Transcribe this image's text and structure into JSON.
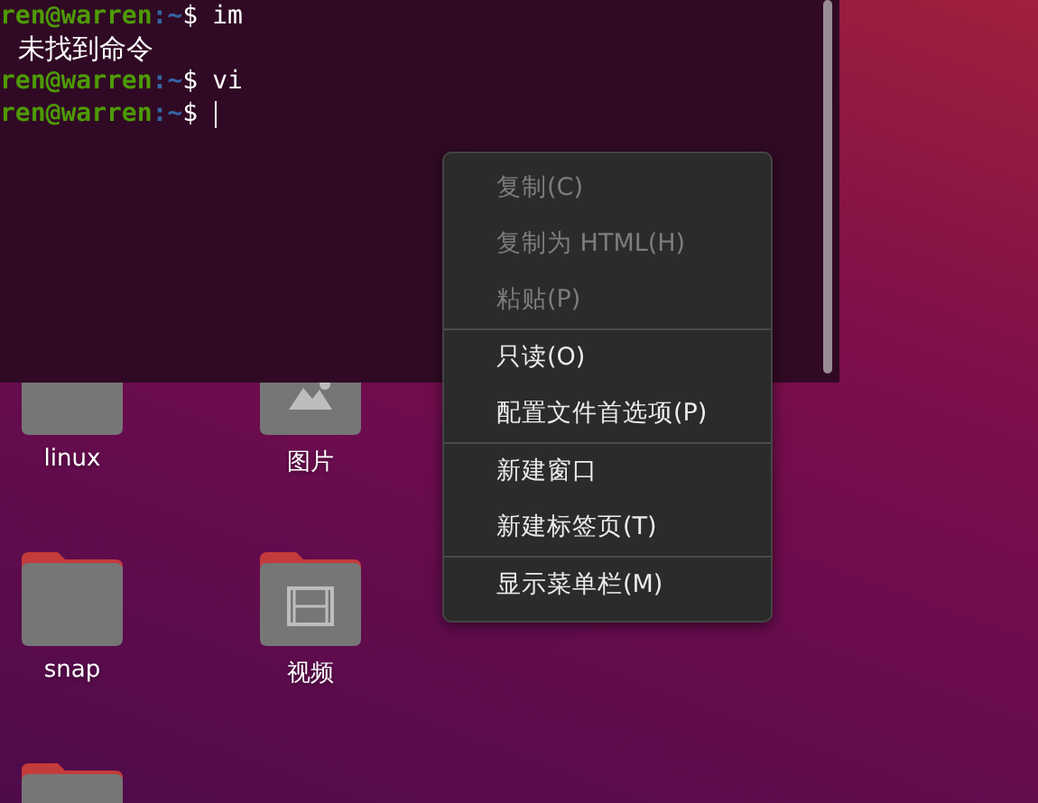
{
  "terminal": {
    "lines": [
      {
        "kind": "prompt",
        "user": "ren@warren",
        "path": ":~",
        "sign": "$",
        "command": "im",
        "cursor": false
      },
      {
        "kind": "output",
        "text": "未找到命令"
      },
      {
        "kind": "prompt",
        "user": "ren@warren",
        "path": ":~",
        "sign": "$",
        "command": "vi",
        "cursor": false
      },
      {
        "kind": "prompt",
        "user": "ren@warren",
        "path": ":~",
        "sign": "$",
        "cursor": true
      }
    ]
  },
  "desktop_icons": [
    {
      "label": "linux",
      "kind": "folder"
    },
    {
      "label": "图片",
      "kind": "pictures"
    },
    {
      "label": "snap",
      "kind": "folder"
    },
    {
      "label": "视频",
      "kind": "videos"
    },
    {
      "kind": "folder"
    }
  ],
  "context_menu": {
    "groups": [
      [
        {
          "label": "复制(C)",
          "disabled": true
        },
        {
          "label": "复制为 HTML(H)",
          "disabled": true
        },
        {
          "label": "粘贴(P)",
          "disabled": true
        }
      ],
      [
        {
          "label": "只读(O)",
          "disabled": false
        },
        {
          "label": "配置文件首选项(P)",
          "disabled": false
        }
      ],
      [
        {
          "label": "新建窗口",
          "disabled": false
        },
        {
          "label": "新建标签页(T)",
          "disabled": false
        }
      ],
      [
        {
          "label": "显示菜单栏(M)",
          "disabled": false
        }
      ]
    ]
  }
}
